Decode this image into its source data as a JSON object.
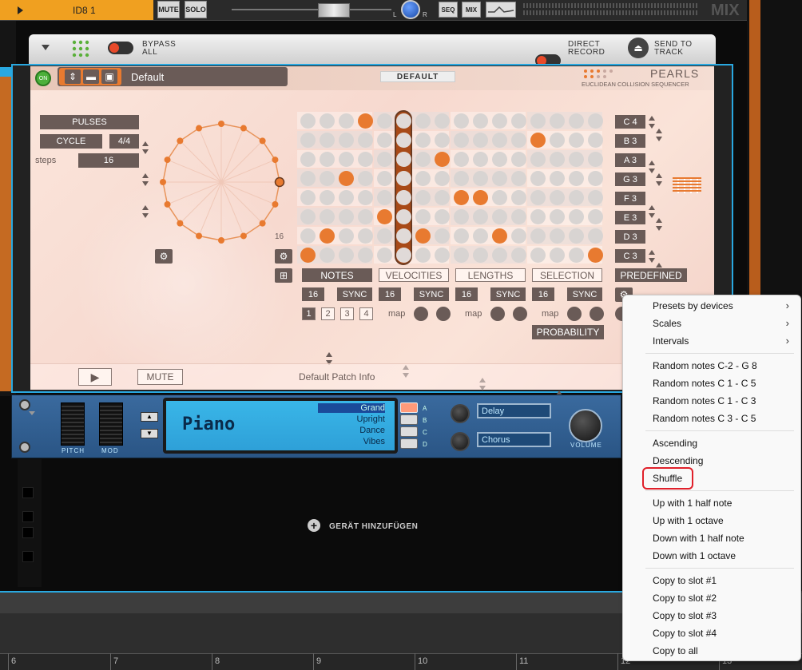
{
  "topbar": {
    "track_name": "ID8 1",
    "mute": "MUTE",
    "solo": "SOLO",
    "pan_l": "L",
    "pan_r": "R",
    "seq": "SEQ",
    "mix": "MIX",
    "mix_title": "MIX"
  },
  "device_header": {
    "bypass_1": "BYPASS",
    "bypass_2": "ALL",
    "direct_1": "DIRECT",
    "direct_2": "RECORD",
    "send_1": "SEND TO",
    "send_2": "TRACK"
  },
  "pearls": {
    "on": "ON",
    "patch_name": "Default",
    "preset_label": "DEFAULT",
    "title": "PEARLS",
    "subtitle": "EUCLIDEAN COLLISION SEQUENCER",
    "pulses": "PULSES",
    "cycle": "CYCLE",
    "cycle_value": "4/4",
    "steps_label": "steps",
    "steps_value": "16",
    "circle_count": "16",
    "notes": [
      "C 4",
      "B 3",
      "A 3",
      "G 3",
      "F 3",
      "E 3",
      "D 3",
      "C 3"
    ],
    "tabs": [
      "NOTES",
      "VELOCITIES",
      "LENGTHS",
      "SELECTION"
    ],
    "predefined": "PREDEFINED",
    "sync": "SYNC",
    "sync_values": [
      "16",
      "16",
      "16",
      "16"
    ],
    "map": "map",
    "slots": [
      "1",
      "2",
      "3",
      "4"
    ],
    "probability": "PROBABILITY",
    "mute": "MUTE",
    "patch_info": "Default Patch Info",
    "grid": [
      [
        3
      ],
      [
        12
      ],
      [
        7
      ],
      [
        2
      ],
      [
        8,
        9
      ],
      [
        4
      ],
      [
        1,
        6,
        10
      ],
      [
        0,
        15
      ]
    ],
    "playhead_column": 5
  },
  "instrument": {
    "lcd_name": "Piano",
    "patches": [
      "Grand",
      "Upright",
      "Dance",
      "Vibes"
    ],
    "slot_letters": [
      "A",
      "B",
      "C",
      "D"
    ],
    "fx1": "Delay",
    "fx2": "Chorus",
    "pitch": "PITCH",
    "mod": "MOD",
    "volume": "VOLUME"
  },
  "add_device": "GERÄT HINZUFÜGEN",
  "ruler": [
    "6",
    "7",
    "8",
    "9",
    "10",
    "11",
    "12",
    "13"
  ],
  "menu": {
    "group1": [
      "Presets by devices",
      "Scales",
      "Intervals"
    ],
    "group2": [
      "Random notes C-2 - G 8",
      "Random notes C 1 - C 5",
      "Random notes C 1 - C 3",
      "Random notes C 3 - C 5"
    ],
    "group3": [
      "Ascending",
      "Descending",
      "Shuffle"
    ],
    "group4": [
      "Up with 1 half note",
      "Up with 1 octave",
      "Down with 1 half note",
      "Down with 1 octave"
    ],
    "group5": [
      "Copy to slot #1",
      "Copy to slot #2",
      "Copy to slot #3",
      "Copy to slot #4",
      "Copy to all"
    ],
    "highlight_color": "#e0202a"
  }
}
